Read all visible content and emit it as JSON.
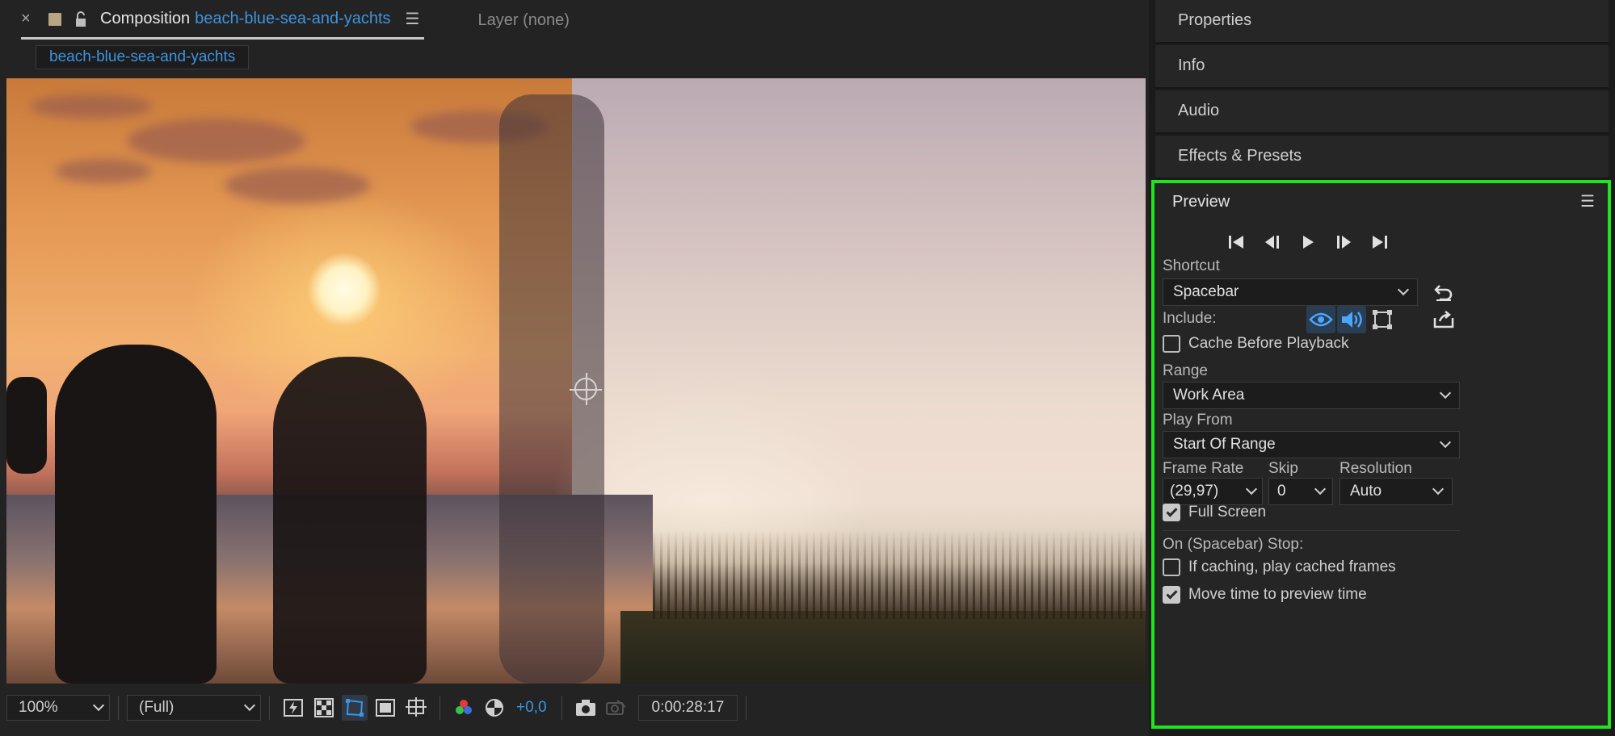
{
  "composition_panel": {
    "tab": {
      "close": "×",
      "title": "Composition",
      "comp_name": "beach-blue-sea-and-yachts",
      "menu": "☰"
    },
    "layer_tab": "Layer (none)",
    "breadcrumb": "beach-blue-sea-and-yachts",
    "toolbar": {
      "zoom": "100%",
      "resolution": "(Full)",
      "exposure": "+0,0",
      "timecode": "0:00:28:17"
    }
  },
  "right_panels": {
    "properties": "Properties",
    "info": "Info",
    "audio": "Audio",
    "effects": "Effects & Presets"
  },
  "preview": {
    "title": "Preview",
    "menu": "☰",
    "shortcut_label": "Shortcut",
    "shortcut_value": "Spacebar",
    "include_label": "Include:",
    "cache_before_playback": "Cache Before Playback",
    "range_label": "Range",
    "range_value": "Work Area",
    "play_from_label": "Play From",
    "play_from_value": "Start Of Range",
    "frame_rate_label": "Frame Rate",
    "frame_rate_value": "(29,97)",
    "skip_label": "Skip",
    "skip_value": "0",
    "resolution_label": "Resolution",
    "resolution_value": "Auto",
    "full_screen": "Full Screen",
    "on_stop_label": "On (Spacebar) Stop:",
    "if_caching": "If caching, play cached frames",
    "move_time": "Move time to preview time",
    "checks": {
      "cache_before_playback": false,
      "full_screen": true,
      "if_caching": false,
      "move_time": true
    }
  },
  "colors": {
    "accent_blue": "#3d94e0",
    "highlight_green": "#1ee61e"
  }
}
